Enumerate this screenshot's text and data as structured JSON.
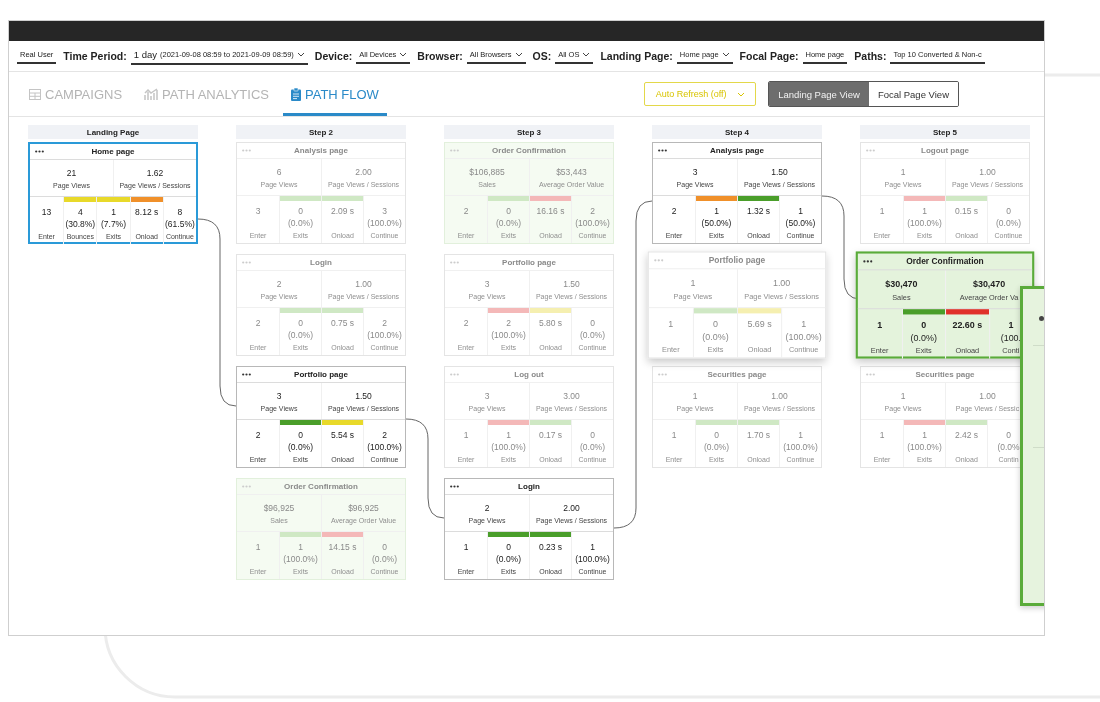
{
  "filters": [
    {
      "kind": "plain",
      "value": "Real User"
    },
    {
      "kind": "select",
      "label": "Time Period:",
      "value": "1 day",
      "detail": "(2021-09-08 08:59 to 2021-09-09 08:59)",
      "dropdown": true
    },
    {
      "kind": "select",
      "label": "Device:",
      "value": "All Devices",
      "dropdown": true
    },
    {
      "kind": "select",
      "label": "Browser:",
      "value": "All Browsers",
      "dropdown": true
    },
    {
      "kind": "select",
      "label": "OS:",
      "value": "All OS",
      "dropdown": true
    },
    {
      "kind": "select",
      "label": "Landing Page:",
      "value": "Home page",
      "dropdown": true
    },
    {
      "kind": "select",
      "label": "Focal Page:",
      "value": "Home page",
      "dropdown": false
    },
    {
      "kind": "select",
      "label": "Paths:",
      "value": "Top 10 Converted & Non-c",
      "dropdown": false
    }
  ],
  "tabs": [
    {
      "label": "CAMPAIGNS",
      "selected": false
    },
    {
      "label": "PATH ANALYTICS",
      "selected": false
    },
    {
      "label": "PATH FLOW",
      "selected": true
    }
  ],
  "auto_refresh": {
    "label": "Auto Refresh (off)"
  },
  "view_toggle": [
    {
      "label": "Landing Page View",
      "selected": true
    },
    {
      "label": "Focal Page View",
      "selected": false
    }
  ],
  "columns": [
    {
      "title": "Landing Page",
      "cards": [
        {
          "kind": "page",
          "selected": true,
          "faded": false,
          "raised": false,
          "title": "Home page",
          "summary": [
            {
              "value": "21",
              "label": "Page Views"
            },
            {
              "value": "1.62",
              "label": "Page Views / Sessions"
            }
          ],
          "metrics": [
            {
              "value": "13",
              "label": "Enter"
            },
            {
              "value": "4",
              "pct": "(30.8%)",
              "label": "Bounces",
              "color": "#e8d92a"
            },
            {
              "value": "1",
              "pct": "(7.7%)",
              "label": "Exits",
              "color": "#e8d92a"
            },
            {
              "value": "8.12 s",
              "label": "Onload",
              "color": "#f0902a"
            },
            {
              "value": "8",
              "pct": "(61.5%)",
              "label": "Continue"
            }
          ]
        }
      ]
    },
    {
      "title": "Step 2",
      "cards": [
        {
          "kind": "page",
          "selected": false,
          "faded": true,
          "raised": false,
          "title": "Analysis page",
          "summary": [
            {
              "value": "6",
              "label": "Page Views"
            },
            {
              "value": "2.00",
              "label": "Page Views / Sessions"
            }
          ],
          "metrics": [
            {
              "value": "3",
              "label": "Enter"
            },
            {
              "value": "0",
              "pct": "(0.0%)",
              "label": "Exits",
              "color": "#cfe8c4"
            },
            {
              "value": "2.09 s",
              "label": "Onload",
              "color": "#cfe8c4"
            },
            {
              "value": "3",
              "pct": "(100.0%)",
              "label": "Continue"
            }
          ]
        },
        {
          "kind": "page",
          "selected": false,
          "faded": true,
          "raised": false,
          "title": "Login",
          "summary": [
            {
              "value": "2",
              "label": "Page Views"
            },
            {
              "value": "1.00",
              "label": "Page Views / Sessions"
            }
          ],
          "metrics": [
            {
              "value": "2",
              "label": "Enter"
            },
            {
              "value": "0",
              "pct": "(0.0%)",
              "label": "Exits",
              "color": "#cfe8c4"
            },
            {
              "value": "0.75 s",
              "label": "Onload",
              "color": "#cfe8c4"
            },
            {
              "value": "2",
              "pct": "(100.0%)",
              "label": "Continue"
            }
          ]
        },
        {
          "kind": "page",
          "selected": false,
          "faded": false,
          "raised": false,
          "title": "Portfolio page",
          "summary": [
            {
              "value": "3",
              "label": "Page Views"
            },
            {
              "value": "1.50",
              "label": "Page Views / Sessions"
            }
          ],
          "metrics": [
            {
              "value": "2",
              "label": "Enter"
            },
            {
              "value": "0",
              "pct": "(0.0%)",
              "label": "Exits",
              "color": "#4a9e2a"
            },
            {
              "value": "5.54 s",
              "label": "Onload",
              "color": "#e8d92a"
            },
            {
              "value": "2",
              "pct": "(100.0%)",
              "label": "Continue"
            }
          ]
        },
        {
          "kind": "conversion",
          "selected": false,
          "faded": true,
          "raised": false,
          "title": "Order Confirmation",
          "summary": [
            {
              "value": "$96,925",
              "label": "Sales"
            },
            {
              "value": "$96,925",
              "label": "Average Order Value"
            }
          ],
          "metrics": [
            {
              "value": "1",
              "label": "Enter"
            },
            {
              "value": "1",
              "pct": "(100.0%)",
              "label": "Exits",
              "color": "#cfe8c4"
            },
            {
              "value": "14.15 s",
              "label": "Onload",
              "color": "#f4b8b8"
            },
            {
              "value": "0",
              "pct": "(0.0%)",
              "label": "Continue"
            }
          ]
        }
      ]
    },
    {
      "title": "Step 3",
      "cards": [
        {
          "kind": "conversion",
          "selected": false,
          "faded": true,
          "raised": false,
          "title": "Order Confirmation",
          "summary": [
            {
              "value": "$106,885",
              "label": "Sales"
            },
            {
              "value": "$53,443",
              "label": "Average Order Value"
            }
          ],
          "metrics": [
            {
              "value": "2",
              "label": "Enter"
            },
            {
              "value": "0",
              "pct": "(0.0%)",
              "label": "Exits",
              "color": "#cfe8c4"
            },
            {
              "value": "16.16 s",
              "label": "Onload",
              "color": "#f4b8b8"
            },
            {
              "value": "2",
              "pct": "(100.0%)",
              "label": "Continue"
            }
          ]
        },
        {
          "kind": "page",
          "selected": false,
          "faded": true,
          "raised": false,
          "title": "Portfolio page",
          "summary": [
            {
              "value": "3",
              "label": "Page Views"
            },
            {
              "value": "1.50",
              "label": "Page Views / Sessions"
            }
          ],
          "metrics": [
            {
              "value": "2",
              "label": "Enter"
            },
            {
              "value": "2",
              "pct": "(100.0%)",
              "label": "Exits",
              "color": "#f4b8b8"
            },
            {
              "value": "5.80 s",
              "label": "Onload",
              "color": "#f5efb0"
            },
            {
              "value": "0",
              "pct": "(0.0%)",
              "label": "Continue"
            }
          ]
        },
        {
          "kind": "page",
          "selected": false,
          "faded": true,
          "raised": false,
          "title": "Log out",
          "summary": [
            {
              "value": "3",
              "label": "Page Views"
            },
            {
              "value": "3.00",
              "label": "Page Views / Sessions"
            }
          ],
          "metrics": [
            {
              "value": "1",
              "label": "Enter"
            },
            {
              "value": "1",
              "pct": "(100.0%)",
              "label": "Exits",
              "color": "#f4b8b8"
            },
            {
              "value": "0.17 s",
              "label": "Onload",
              "color": "#cfe8c4"
            },
            {
              "value": "0",
              "pct": "(0.0%)",
              "label": "Continue"
            }
          ]
        },
        {
          "kind": "page",
          "selected": false,
          "faded": false,
          "raised": false,
          "title": "Login",
          "summary": [
            {
              "value": "2",
              "label": "Page Views"
            },
            {
              "value": "2.00",
              "label": "Page Views / Sessions"
            }
          ],
          "metrics": [
            {
              "value": "1",
              "label": "Enter"
            },
            {
              "value": "0",
              "pct": "(0.0%)",
              "label": "Exits",
              "color": "#4a9e2a"
            },
            {
              "value": "0.23 s",
              "label": "Onload",
              "color": "#4a9e2a"
            },
            {
              "value": "1",
              "pct": "(100.0%)",
              "label": "Continue"
            }
          ]
        }
      ]
    },
    {
      "title": "Step 4",
      "cards": [
        {
          "kind": "page",
          "selected": false,
          "faded": false,
          "raised": false,
          "title": "Analysis page",
          "summary": [
            {
              "value": "3",
              "label": "Page Views"
            },
            {
              "value": "1.50",
              "label": "Page Views / Sessions"
            }
          ],
          "metrics": [
            {
              "value": "2",
              "label": "Enter"
            },
            {
              "value": "1",
              "pct": "(50.0%)",
              "label": "Exits",
              "color": "#f0902a"
            },
            {
              "value": "1.32 s",
              "label": "Onload",
              "color": "#4a9e2a"
            },
            {
              "value": "1",
              "pct": "(50.0%)",
              "label": "Continue"
            }
          ]
        },
        {
          "kind": "page",
          "selected": false,
          "faded": true,
          "raised": true,
          "title": "Portfolio page",
          "summary": [
            {
              "value": "1",
              "label": "Page Views"
            },
            {
              "value": "1.00",
              "label": "Page Views / Sessions"
            }
          ],
          "metrics": [
            {
              "value": "1",
              "label": "Enter"
            },
            {
              "value": "0",
              "pct": "(0.0%)",
              "label": "Exits",
              "color": "#cfe8c4"
            },
            {
              "value": "5.69 s",
              "label": "Onload",
              "color": "#f5efb0"
            },
            {
              "value": "1",
              "pct": "(100.0%)",
              "label": "Continue"
            }
          ]
        },
        {
          "kind": "page",
          "selected": false,
          "faded": true,
          "raised": false,
          "title": "Securities page",
          "summary": [
            {
              "value": "1",
              "label": "Page Views"
            },
            {
              "value": "1.00",
              "label": "Page Views / Sessions"
            }
          ],
          "metrics": [
            {
              "value": "1",
              "label": "Enter"
            },
            {
              "value": "0",
              "pct": "(0.0%)",
              "label": "Exits",
              "color": "#cfe8c4"
            },
            {
              "value": "1.70 s",
              "label": "Onload",
              "color": "#cfe8c4"
            },
            {
              "value": "1",
              "pct": "(100.0%)",
              "label": "Continue"
            }
          ]
        }
      ]
    },
    {
      "title": "Step 5",
      "cards": [
        {
          "kind": "page",
          "selected": false,
          "faded": true,
          "raised": false,
          "title": "Logout page",
          "summary": [
            {
              "value": "1",
              "label": "Page Views"
            },
            {
              "value": "1.00",
              "label": "Page Views / Sessions"
            }
          ],
          "metrics": [
            {
              "value": "1",
              "label": "Enter"
            },
            {
              "value": "1",
              "pct": "(100.0%)",
              "label": "Exits",
              "color": "#f4b8b8"
            },
            {
              "value": "0.15 s",
              "label": "Onload",
              "color": "#cfe8c4"
            },
            {
              "value": "0",
              "pct": "(0.0%)",
              "label": "Continue"
            }
          ]
        },
        {
          "kind": "conversion",
          "selected": false,
          "faded": false,
          "raised": true,
          "title": "Order Confirmation",
          "summary": [
            {
              "value": "$30,470",
              "label": "Sales"
            },
            {
              "value": "$30,470",
              "label": "Average Order Va"
            }
          ],
          "metrics": [
            {
              "value": "1",
              "label": "Enter"
            },
            {
              "value": "0",
              "pct": "(0.0%)",
              "label": "Exits",
              "color": "#4a9e2a"
            },
            {
              "value": "22.60 s",
              "label": "Onload",
              "color": "#e0302a"
            },
            {
              "value": "1",
              "pct": "(100.",
              "label": "Conti"
            }
          ]
        },
        {
          "kind": "page",
          "selected": false,
          "faded": true,
          "raised": false,
          "title": "Securities page",
          "summary": [
            {
              "value": "1",
              "label": "Page Views"
            },
            {
              "value": "1.00",
              "label": "Page Views / Sessic"
            }
          ],
          "metrics": [
            {
              "value": "1",
              "label": "Enter"
            },
            {
              "value": "1",
              "pct": "(100.0%)",
              "label": "Exits",
              "color": "#f4b8b8"
            },
            {
              "value": "2.42 s",
              "label": "Onload",
              "color": "#cfe8c4"
            },
            {
              "value": "0",
              "pct": "(0.0%",
              "label": "Contin"
            }
          ]
        }
      ]
    }
  ]
}
